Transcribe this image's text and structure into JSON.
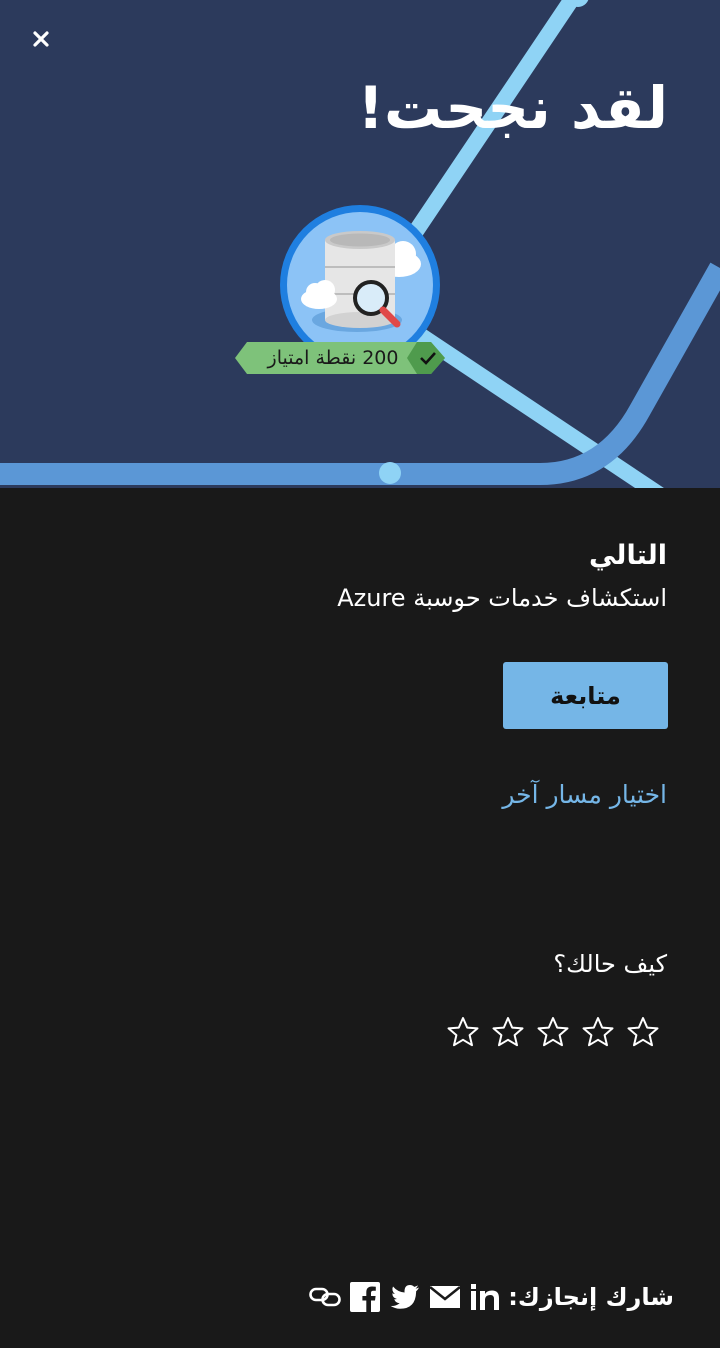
{
  "hero": {
    "title": "لقد نجحت!",
    "points_text": "200 نقطة امتياز"
  },
  "next": {
    "label": "التالي",
    "module": "استكشاف خدمات حوسبة Azure",
    "continue_label": "متابعة",
    "other_path_label": "اختيار مسار آخر"
  },
  "feedback": {
    "question": "كيف حالك؟",
    "rating_max": 5,
    "rating_value": 0
  },
  "share": {
    "label": "شارك إنجازك:",
    "icons": [
      "linkedin-icon",
      "email-icon",
      "twitter-icon",
      "facebook-icon",
      "link-icon"
    ]
  },
  "colors": {
    "hero_bg": "#2c3a5c",
    "page_bg": "#191919",
    "accent": "#75b6e7",
    "ribbon_green": "#7ec27a"
  }
}
